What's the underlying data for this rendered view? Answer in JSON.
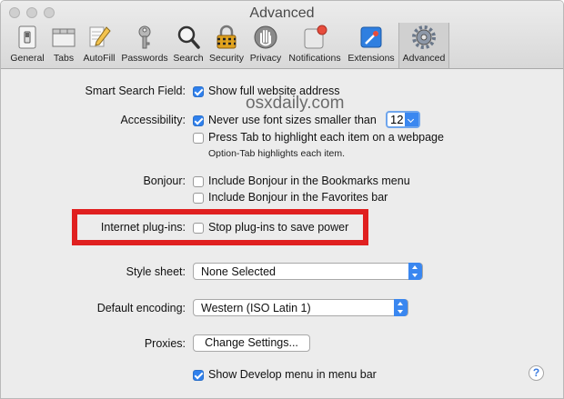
{
  "window": {
    "title": "Advanced"
  },
  "toolbar": {
    "items": [
      {
        "label": "General",
        "icon": "switch-icon"
      },
      {
        "label": "Tabs",
        "icon": "tabs-icon"
      },
      {
        "label": "AutoFill",
        "icon": "pencil-icon"
      },
      {
        "label": "Passwords",
        "icon": "key-icon"
      },
      {
        "label": "Search",
        "icon": "magnifier-icon"
      },
      {
        "label": "Security",
        "icon": "lock-icon"
      },
      {
        "label": "Privacy",
        "icon": "hand-icon"
      },
      {
        "label": "Notifications",
        "icon": "notification-icon"
      },
      {
        "label": "Extensions",
        "icon": "extensions-icon"
      },
      {
        "label": "Advanced",
        "icon": "gear-icon"
      }
    ],
    "active": "Advanced"
  },
  "watermark": "osxdaily.com",
  "settings": {
    "smart_search": {
      "label": "Smart Search Field:",
      "option": "Show full website address",
      "checked": true
    },
    "accessibility": {
      "label": "Accessibility:",
      "option1": "Never use font sizes smaller than",
      "option1_checked": true,
      "font_size": "12",
      "option2": "Press Tab to highlight each item on a webpage",
      "option2_checked": false,
      "hint": "Option-Tab highlights each item."
    },
    "bonjour": {
      "label": "Bonjour:",
      "option1": "Include Bonjour in the Bookmarks menu",
      "option2": "Include Bonjour in the Favorites bar",
      "checked1": false,
      "checked2": false
    },
    "plugins": {
      "label": "Internet plug-ins:",
      "option": "Stop plug-ins to save power",
      "checked": false
    },
    "style_sheet": {
      "label": "Style sheet:",
      "value": "None Selected"
    },
    "encoding": {
      "label": "Default encoding:",
      "value": "Western (ISO Latin 1)"
    },
    "proxies": {
      "label": "Proxies:",
      "button": "Change Settings..."
    },
    "develop": {
      "option": "Show Develop menu in menu bar",
      "checked": true
    }
  },
  "help": "?",
  "colors": {
    "accent": "#2f80ed",
    "highlight_box": "#e02020",
    "notification_badge": "#e74c3c"
  }
}
